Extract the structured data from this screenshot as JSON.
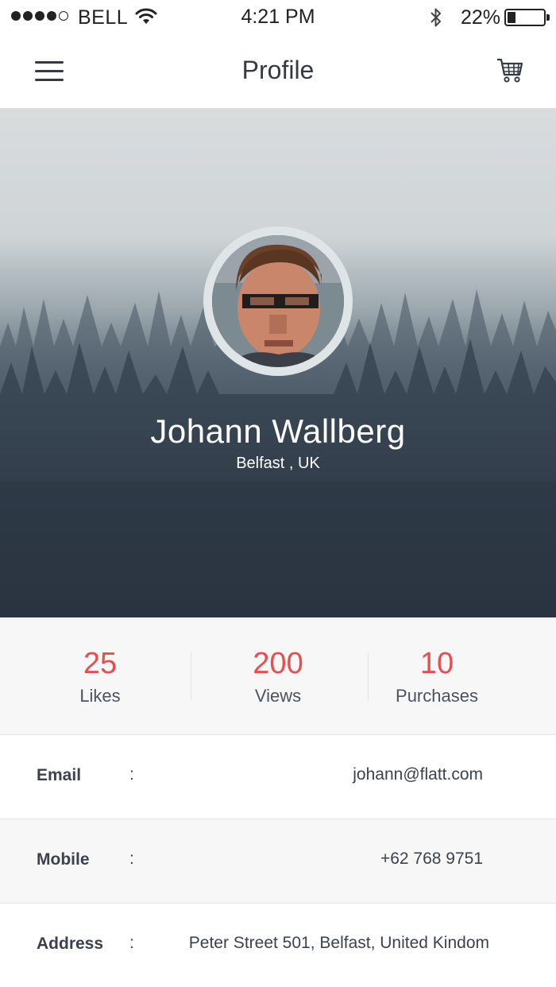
{
  "status_bar": {
    "carrier": "BELL",
    "time": "4:21 PM",
    "battery_percent_label": "22%",
    "battery_level": 0.22,
    "signal_bars_filled": 4,
    "signal_bars_total": 5
  },
  "nav": {
    "title": "Profile",
    "menu_icon": "hamburger-menu-icon",
    "cart_icon": "shopping-cart-icon"
  },
  "profile": {
    "name": "Johann Wallberg",
    "location": "Belfast , UK"
  },
  "stats": [
    {
      "value": "25",
      "label": "Likes"
    },
    {
      "value": "200",
      "label": "Views"
    },
    {
      "value": "10",
      "label": "Purchases"
    }
  ],
  "info": [
    {
      "label": "Email",
      "colon": ":",
      "value": "johann@flatt.com"
    },
    {
      "label": "Mobile",
      "colon": ":",
      "value": "+62 768 9751"
    },
    {
      "label": "Address",
      "colon": ":",
      "value": "Peter Street 501, Belfast, United Kindom"
    }
  ],
  "colors": {
    "accent": "#e94e4e",
    "text": "#333a44",
    "hero_dark": "#2f3a48"
  }
}
